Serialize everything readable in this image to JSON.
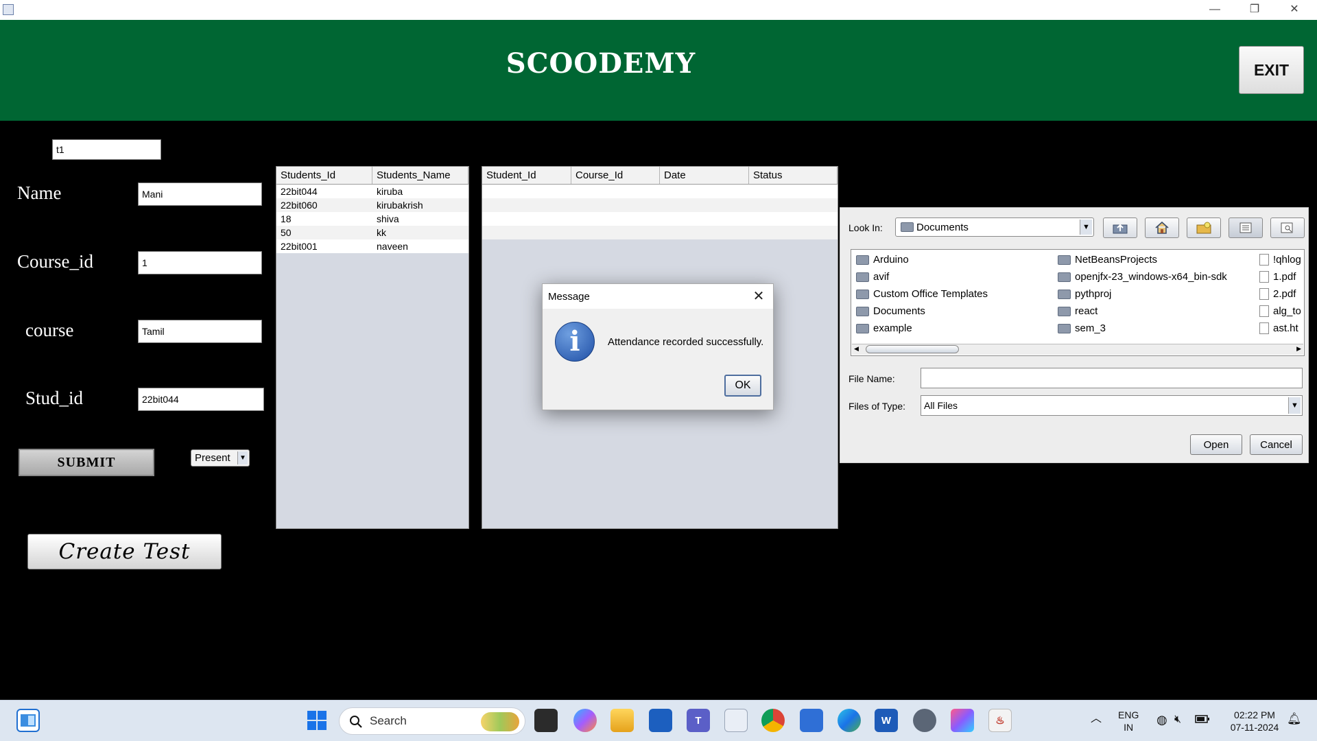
{
  "window": {
    "controls": {
      "minimize": "—",
      "restore": "❐",
      "close": "✕"
    }
  },
  "header": {
    "brand": "SCOODEMY",
    "exit_label": "EXIT"
  },
  "form": {
    "test_field_value": "t1",
    "name_label": "Name",
    "name_value": "Mani",
    "course_id_label": "Course_id",
    "course_id_value": "1",
    "course_label": "course",
    "course_value": "Tamil",
    "stud_id_label": "Stud_id",
    "stud_id_value": "22bit044",
    "submit_label": "SUBMIT",
    "status_selected": "Present",
    "create_test_label": "Create Test"
  },
  "students_table": {
    "columns": [
      "Students_Id",
      "Students_Name"
    ],
    "rows": [
      [
        "22bit044",
        "kiruba"
      ],
      [
        "22bit060",
        "kirubakrish"
      ],
      [
        "18",
        "shiva"
      ],
      [
        "50",
        "kk"
      ],
      [
        "22bit001",
        "naveen"
      ]
    ]
  },
  "attendance_table": {
    "columns": [
      "Student_Id",
      "Course_Id",
      "Date",
      "Status"
    ],
    "rows": []
  },
  "file_chooser": {
    "look_in_label": "Look In:",
    "look_in_value": "Documents",
    "items": [
      {
        "name": "Arduino",
        "type": "folder"
      },
      {
        "name": "avif",
        "type": "folder"
      },
      {
        "name": "Custom Office Templates",
        "type": "folder"
      },
      {
        "name": "Documents",
        "type": "folder"
      },
      {
        "name": "example",
        "type": "folder"
      },
      {
        "name": "NetBeansProjects",
        "type": "folder"
      },
      {
        "name": "openjfx-23_windows-x64_bin-sdk",
        "type": "folder"
      },
      {
        "name": "pythproj",
        "type": "folder"
      },
      {
        "name": "react",
        "type": "folder"
      },
      {
        "name": "sem_3",
        "type": "folder"
      },
      {
        "name": "!qhlog",
        "type": "file"
      },
      {
        "name": "1.pdf",
        "type": "file"
      },
      {
        "name": "2.pdf",
        "type": "file"
      },
      {
        "name": "alg_to",
        "type": "file"
      },
      {
        "name": "ast.ht",
        "type": "file"
      }
    ],
    "file_name_label": "File Name:",
    "file_name_value": "",
    "files_of_type_label": "Files of Type:",
    "files_of_type_value": "All Files",
    "open_label": "Open",
    "cancel_label": "Cancel"
  },
  "dialog": {
    "title": "Message",
    "close": "✕",
    "icon_glyph": "i",
    "message": "Attendance recorded successfully.",
    "ok_label": "OK"
  },
  "taskbar": {
    "search_placeholder": "Search",
    "language_line1": "ENG",
    "language_line2": "IN",
    "time": "02:22 PM",
    "date": "07-11-2024"
  },
  "colors": {
    "header_green": "#006633",
    "background": "#000000",
    "table_empty": "#d5d9e2",
    "info_blue": "#2a5db0"
  }
}
